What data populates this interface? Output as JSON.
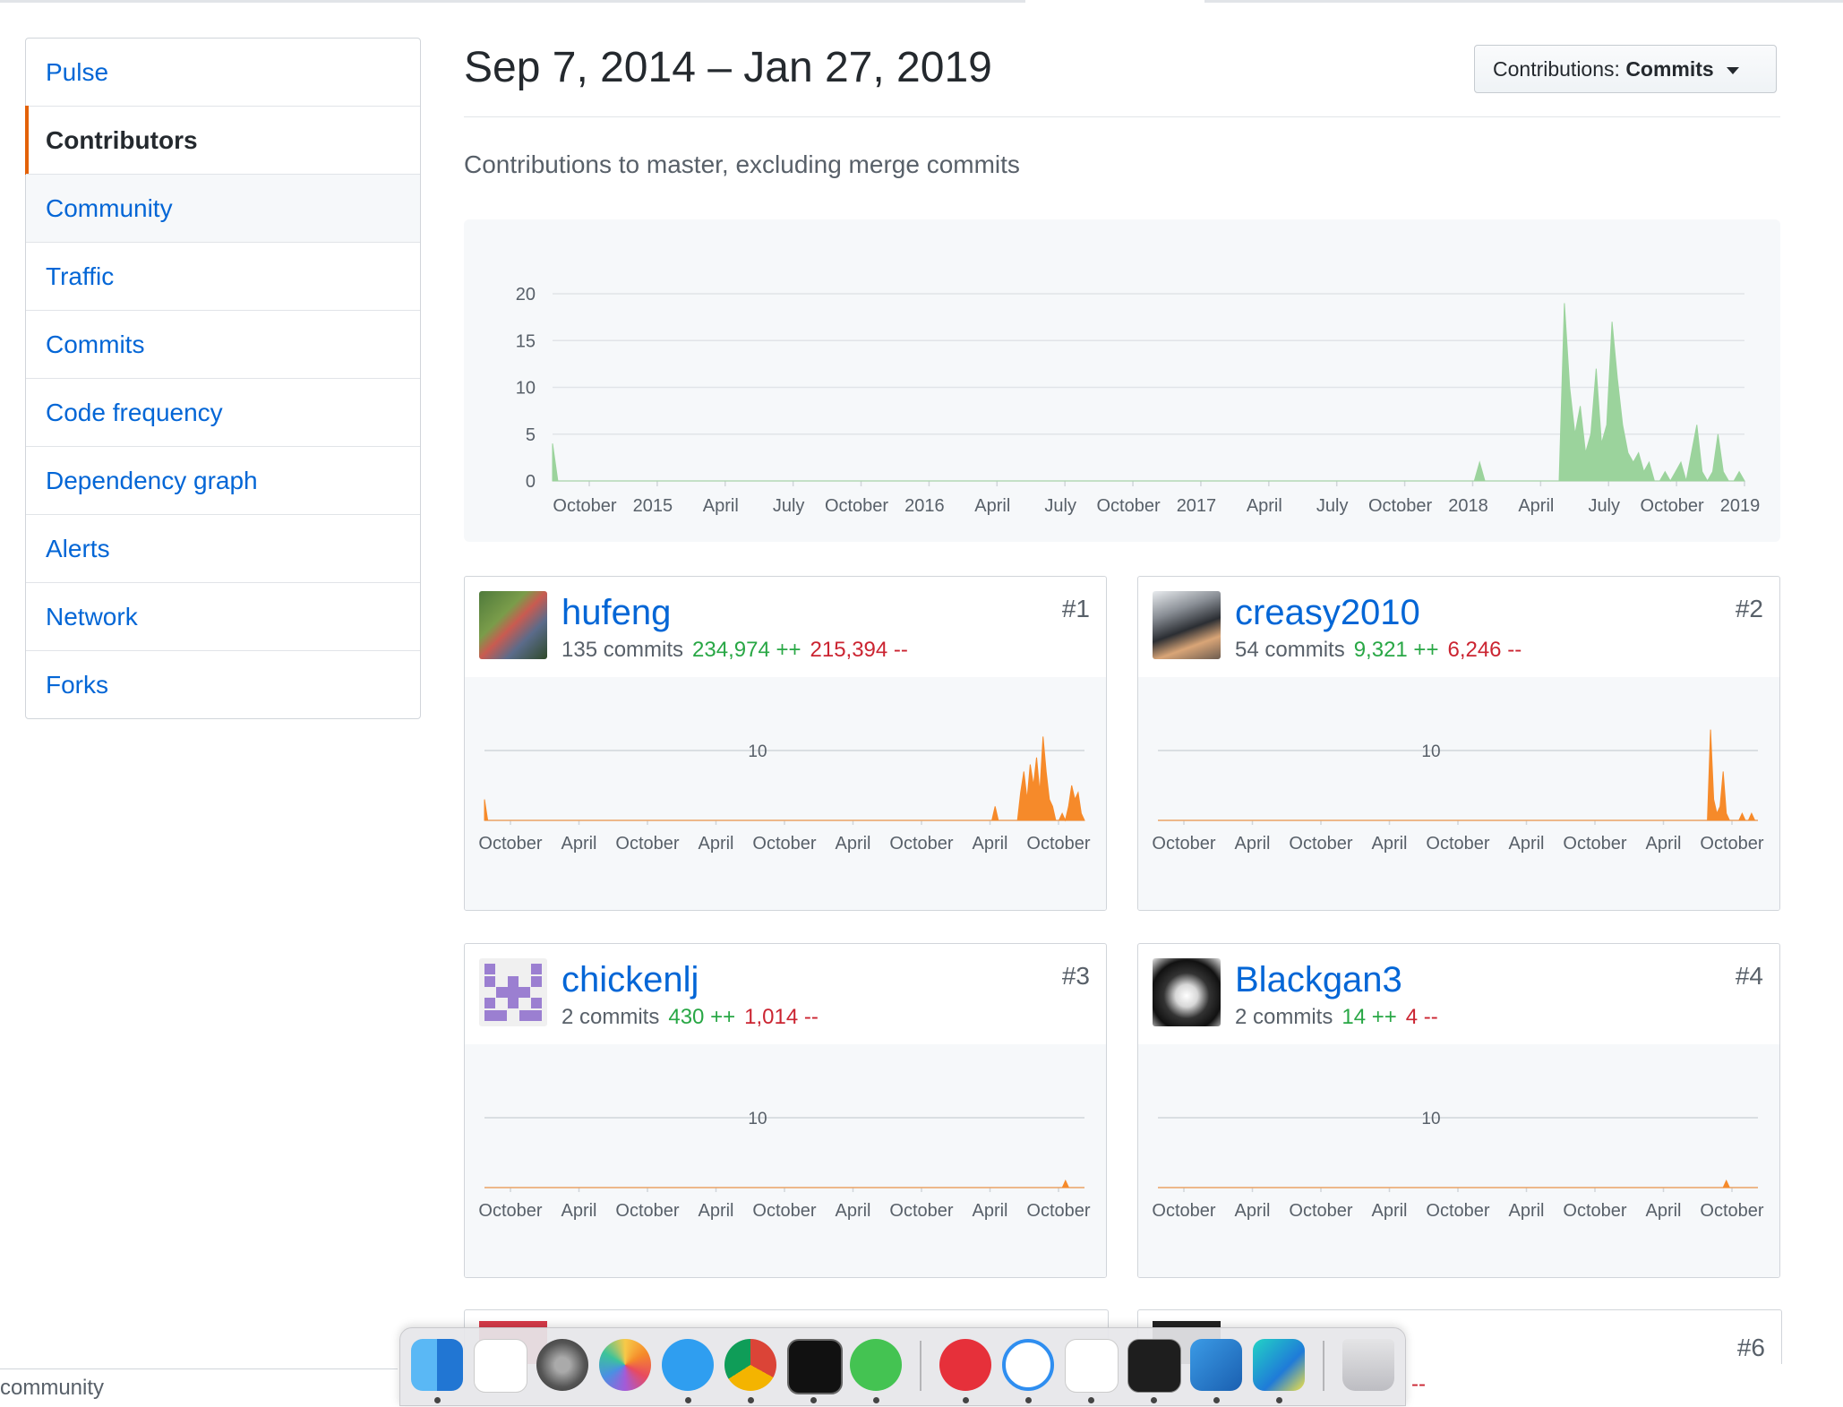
{
  "sidebar": {
    "items": [
      {
        "label": "Pulse"
      },
      {
        "label": "Contributors"
      },
      {
        "label": "Community"
      },
      {
        "label": "Traffic"
      },
      {
        "label": "Commits"
      },
      {
        "label": "Code frequency"
      },
      {
        "label": "Dependency graph"
      },
      {
        "label": "Alerts"
      },
      {
        "label": "Network"
      },
      {
        "label": "Forks"
      }
    ]
  },
  "header": {
    "date_range": "Sep 7, 2014 – Jan 27, 2019",
    "select_prefix": "Contributions:",
    "select_value": "Commits",
    "subtitle": "Contributions to master, excluding merge commits"
  },
  "chart_data": [
    {
      "type": "area",
      "yticks": [
        0,
        5,
        10,
        15,
        20
      ],
      "ylim": [
        0,
        20
      ],
      "x_labels": [
        "October",
        "2015",
        "April",
        "July",
        "October",
        "2016",
        "April",
        "July",
        "October",
        "2017",
        "April",
        "July",
        "October",
        "2018",
        "April",
        "July",
        "October",
        "2019"
      ],
      "series": [
        {
          "values": [
            4,
            0,
            0,
            0,
            0,
            0,
            0,
            0,
            0,
            0,
            0,
            0,
            0,
            0,
            0,
            0,
            0,
            0,
            0,
            0,
            0,
            0,
            0,
            0,
            0,
            0,
            0,
            0,
            0,
            0,
            0,
            0,
            0,
            0,
            0,
            0,
            0,
            0,
            0,
            0,
            0,
            0,
            0,
            0,
            0,
            0,
            0,
            0,
            0,
            0,
            0,
            0,
            0,
            0,
            0,
            0,
            0,
            0,
            0,
            0,
            0,
            0,
            0,
            0,
            0,
            0,
            0,
            0,
            0,
            0,
            0,
            0,
            0,
            0,
            0,
            0,
            0,
            0,
            0,
            0,
            0,
            0,
            0,
            0,
            0,
            0,
            0,
            0,
            0,
            0,
            0,
            0,
            0,
            0,
            0,
            0,
            0,
            0,
            0,
            0,
            0,
            0,
            0,
            0,
            0,
            0,
            0,
            0,
            0,
            0,
            0,
            0,
            0,
            0,
            0,
            0,
            0,
            0,
            0,
            0,
            0,
            0,
            0,
            0,
            0,
            0,
            0,
            0,
            0,
            0,
            0,
            0,
            0,
            0,
            0,
            0,
            0,
            0,
            0,
            0,
            0,
            0,
            0,
            0,
            0,
            0,
            0,
            0,
            0,
            0,
            0,
            0,
            0,
            0,
            0,
            0,
            0,
            0,
            0,
            0,
            0,
            0,
            0,
            0,
            0,
            0,
            0,
            0,
            0,
            0,
            0,
            0,
            0,
            0,
            0,
            2,
            0,
            0,
            0,
            0,
            0,
            0,
            0,
            0,
            0,
            0,
            0,
            0,
            0,
            0,
            0,
            19,
            10,
            5,
            8,
            3,
            5,
            12,
            4,
            6,
            17,
            11,
            6,
            3,
            2,
            3,
            1,
            2,
            0,
            0,
            1,
            0,
            1,
            2,
            0,
            3,
            6,
            1,
            0,
            1,
            5,
            1,
            0,
            0,
            1,
            0
          ]
        }
      ]
    },
    {
      "type": "area",
      "user": "hufeng",
      "yticks": [
        10
      ],
      "x_labels": [
        "October",
        "April",
        "October",
        "April",
        "October",
        "April",
        "October",
        "April",
        "October"
      ],
      "series": [
        {
          "values": [
            3,
            0,
            0,
            0,
            0,
            0,
            0,
            0,
            0,
            0,
            0,
            0,
            0,
            0,
            0,
            0,
            0,
            0,
            0,
            0,
            0,
            0,
            0,
            0,
            0,
            0,
            0,
            0,
            0,
            0,
            0,
            0,
            0,
            0,
            0,
            0,
            0,
            0,
            0,
            0,
            0,
            0,
            0,
            0,
            0,
            0,
            0,
            0,
            0,
            0,
            0,
            0,
            0,
            0,
            0,
            0,
            0,
            0,
            0,
            0,
            0,
            0,
            0,
            0,
            0,
            0,
            0,
            0,
            0,
            0,
            0,
            0,
            0,
            0,
            0,
            0,
            0,
            0,
            0,
            0,
            0,
            0,
            0,
            0,
            0,
            0,
            0,
            0,
            0,
            0,
            0,
            0,
            0,
            0,
            0,
            0,
            0,
            0,
            0,
            0,
            0,
            0,
            0,
            0,
            0,
            0,
            0,
            0,
            0,
            0,
            0,
            0,
            0,
            0,
            0,
            0,
            0,
            0,
            0,
            0,
            0,
            0,
            0,
            0,
            0,
            0,
            0,
            0,
            0,
            0,
            0,
            0,
            0,
            0,
            0,
            0,
            0,
            0,
            0,
            0,
            0,
            0,
            0,
            0,
            0,
            0,
            0,
            0,
            0,
            0,
            0,
            0,
            0,
            0,
            0,
            0,
            0,
            0,
            0,
            0,
            2,
            0,
            0,
            0,
            0,
            0,
            0,
            0,
            4,
            7,
            3,
            8,
            5,
            9,
            4,
            12,
            7,
            3,
            2,
            0,
            0,
            1,
            0,
            2,
            5,
            3,
            4,
            1,
            0
          ]
        }
      ]
    },
    {
      "type": "area",
      "user": "creasy2010",
      "yticks": [
        10
      ],
      "x_labels": [
        "October",
        "April",
        "October",
        "April",
        "October",
        "April",
        "October",
        "April",
        "October"
      ],
      "series": [
        {
          "values": [
            0,
            0,
            0,
            0,
            0,
            0,
            0,
            0,
            0,
            0,
            0,
            0,
            0,
            0,
            0,
            0,
            0,
            0,
            0,
            0,
            0,
            0,
            0,
            0,
            0,
            0,
            0,
            0,
            0,
            0,
            0,
            0,
            0,
            0,
            0,
            0,
            0,
            0,
            0,
            0,
            0,
            0,
            0,
            0,
            0,
            0,
            0,
            0,
            0,
            0,
            0,
            0,
            0,
            0,
            0,
            0,
            0,
            0,
            0,
            0,
            0,
            0,
            0,
            0,
            0,
            0,
            0,
            0,
            0,
            0,
            0,
            0,
            0,
            0,
            0,
            0,
            0,
            0,
            0,
            0,
            0,
            0,
            0,
            0,
            0,
            0,
            0,
            0,
            0,
            0,
            0,
            0,
            0,
            0,
            0,
            0,
            0,
            0,
            0,
            0,
            0,
            0,
            0,
            0,
            0,
            0,
            0,
            0,
            0,
            0,
            0,
            0,
            0,
            0,
            0,
            0,
            0,
            0,
            0,
            0,
            0,
            0,
            0,
            0,
            0,
            0,
            0,
            0,
            0,
            0,
            0,
            0,
            0,
            0,
            0,
            0,
            0,
            0,
            0,
            0,
            0,
            0,
            0,
            0,
            0,
            0,
            0,
            0,
            0,
            0,
            0,
            0,
            0,
            0,
            0,
            0,
            0,
            0,
            0,
            0,
            0,
            0,
            0,
            0,
            0,
            0,
            0,
            0,
            0,
            0,
            0,
            0,
            0,
            0,
            0,
            13,
            3,
            1,
            2,
            7,
            1,
            0,
            0,
            0,
            0,
            1,
            0,
            0,
            1,
            0,
            0
          ]
        }
      ]
    },
    {
      "type": "area",
      "user": "chickenlj",
      "yticks": [
        10
      ],
      "x_labels": [
        "October",
        "April",
        "October",
        "April",
        "October",
        "April",
        "October",
        "April",
        "October"
      ],
      "series": [
        {
          "values": [
            0,
            0,
            0,
            0,
            0,
            0,
            0,
            0,
            0,
            0,
            0,
            0,
            0,
            0,
            0,
            0,
            0,
            0,
            0,
            0,
            0,
            0,
            0,
            0,
            0,
            0,
            0,
            0,
            0,
            0,
            0,
            0,
            0,
            0,
            0,
            0,
            0,
            0,
            0,
            0,
            0,
            0,
            0,
            0,
            0,
            0,
            0,
            0,
            0,
            0,
            0,
            0,
            0,
            0,
            0,
            0,
            0,
            0,
            0,
            0,
            0,
            0,
            0,
            0,
            0,
            0,
            0,
            0,
            0,
            0,
            0,
            0,
            0,
            0,
            0,
            0,
            0,
            0,
            0,
            0,
            0,
            0,
            0,
            0,
            0,
            0,
            0,
            0,
            0,
            0,
            0,
            0,
            0,
            0,
            0,
            0,
            0,
            0,
            0,
            0,
            0,
            0,
            0,
            0,
            0,
            0,
            0,
            0,
            0,
            0,
            0,
            0,
            0,
            0,
            0,
            0,
            0,
            0,
            0,
            0,
            0,
            0,
            0,
            0,
            0,
            0,
            0,
            0,
            0,
            0,
            0,
            0,
            0,
            0,
            0,
            0,
            0,
            0,
            0,
            0,
            0,
            0,
            0,
            0,
            0,
            0,
            0,
            0,
            0,
            0,
            0,
            0,
            0,
            0,
            0,
            0,
            0,
            0,
            0,
            0,
            0,
            0,
            0,
            0,
            0,
            0,
            0,
            0,
            0,
            0,
            0,
            0,
            0,
            0,
            0,
            0,
            0,
            0,
            0,
            0,
            0,
            0,
            0,
            0,
            1,
            0,
            0,
            0,
            0,
            0,
            0
          ]
        }
      ]
    },
    {
      "type": "area",
      "user": "Blackgan3",
      "yticks": [
        10
      ],
      "x_labels": [
        "October",
        "April",
        "October",
        "April",
        "October",
        "April",
        "October",
        "April",
        "October"
      ],
      "series": [
        {
          "values": [
            0,
            0,
            0,
            0,
            0,
            0,
            0,
            0,
            0,
            0,
            0,
            0,
            0,
            0,
            0,
            0,
            0,
            0,
            0,
            0,
            0,
            0,
            0,
            0,
            0,
            0,
            0,
            0,
            0,
            0,
            0,
            0,
            0,
            0,
            0,
            0,
            0,
            0,
            0,
            0,
            0,
            0,
            0,
            0,
            0,
            0,
            0,
            0,
            0,
            0,
            0,
            0,
            0,
            0,
            0,
            0,
            0,
            0,
            0,
            0,
            0,
            0,
            0,
            0,
            0,
            0,
            0,
            0,
            0,
            0,
            0,
            0,
            0,
            0,
            0,
            0,
            0,
            0,
            0,
            0,
            0,
            0,
            0,
            0,
            0,
            0,
            0,
            0,
            0,
            0,
            0,
            0,
            0,
            0,
            0,
            0,
            0,
            0,
            0,
            0,
            0,
            0,
            0,
            0,
            0,
            0,
            0,
            0,
            0,
            0,
            0,
            0,
            0,
            0,
            0,
            0,
            0,
            0,
            0,
            0,
            0,
            0,
            0,
            0,
            0,
            0,
            0,
            0,
            0,
            0,
            0,
            0,
            0,
            0,
            0,
            0,
            0,
            0,
            0,
            0,
            0,
            0,
            0,
            0,
            0,
            0,
            0,
            0,
            0,
            0,
            0,
            0,
            0,
            0,
            0,
            0,
            0,
            0,
            0,
            0,
            0,
            0,
            0,
            0,
            0,
            0,
            0,
            0,
            0,
            0,
            0,
            0,
            0,
            0,
            0,
            0,
            0,
            0,
            0,
            0,
            1,
            0,
            0,
            0,
            0,
            0,
            0,
            0,
            0,
            0,
            0
          ]
        }
      ]
    }
  ],
  "contributors": [
    {
      "username": "hufeng",
      "rank": "#1",
      "commits": "135 commits",
      "additions": "234,974 ++",
      "deletions": "215,394 --"
    },
    {
      "username": "creasy2010",
      "rank": "#2",
      "commits": "54 commits",
      "additions": "9,321 ++",
      "deletions": "6,246 --"
    },
    {
      "username": "chickenlj",
      "rank": "#3",
      "commits": "2 commits",
      "additions": "430 ++",
      "deletions": "1,014 --"
    },
    {
      "username": "Blackgan3",
      "rank": "#4",
      "commits": "2 commits",
      "additions": "14 ++",
      "deletions": "4 --"
    }
  ],
  "partial": {
    "rank6": "#6",
    "deletions_fragment": "--"
  },
  "statusbar": {
    "text": "community"
  },
  "dock": {
    "apps": [
      "finder-icon",
      "reminders-icon",
      "system-preferences-icon",
      "photos-icon",
      "dingtalk-icon",
      "chrome-icon",
      "activity-monitor-icon",
      "wechat-icon",
      "wunderlist-icon",
      "lark-icon",
      "baidu-netdisk-icon",
      "terminal-icon",
      "vscode-icon",
      "webstorm-icon",
      "trash-icon"
    ]
  },
  "colors": {
    "link": "#0366d6",
    "add": "#28a745",
    "del": "#cb2431",
    "main_area": "#9bd39c",
    "user_area": "#f68a2a"
  }
}
